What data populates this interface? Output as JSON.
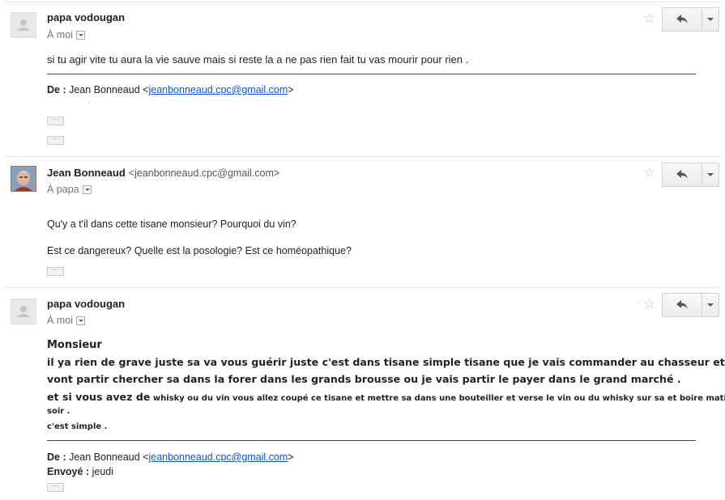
{
  "messages": [
    {
      "sender": "papa vodougan",
      "sender_email": "",
      "recipient": "À moi",
      "body": [
        "si tu agir vite tu aura la vie sauve mais si reste la a ne pas rien fait tu vas mourir pour rien ."
      ],
      "quote": {
        "from_label": "De :",
        "from_name": "Jean Bonneaud <",
        "from_email": "jeanbonneaud.cpc@gmail.com",
        "from_close": ">"
      },
      "ellipsis": [
        "···",
        "···"
      ]
    },
    {
      "sender": "Jean Bonneaud",
      "sender_email": "<jeanbonneaud.cpc@gmail.com>",
      "recipient": "À papa",
      "body": [
        "Qu'y a t'il dans cette tisane monsieur? Pourquoi du vin?",
        "Est ce dangereux? Quelle est la posologie? Est ce homéopathique?"
      ],
      "ellipsis": [
        "···"
      ]
    },
    {
      "sender": "papa vodougan",
      "sender_email": "",
      "recipient": "À moi",
      "body": {
        "salutation": "Monsieur",
        "line1": "il ya rien de grave juste sa va vous guérir  juste c'est dans tisane simple tisane que je vais commander au chasseur et ils",
        "line2": "vont partir chercher sa dans la forer dans les grands brousse ou je vais partir le payer dans le grand marché .",
        "line3_big": "et si vous avez de",
        "line3_small": " whisky ou du vin vous allez coupé ce tisane et mettre sa dans une bouteiller et verse le vin ou du whisky sur sa et boire matin midi",
        "line4": "soir .",
        "line5": "c'est simple ."
      },
      "quote": {
        "from_label": "De :",
        "from_name": "Jean Bonneaud <",
        "from_email": "jeanbonneaud.cpc@gmail.com",
        "from_close": ">",
        "sent_label": "Envoyé :",
        "sent_value": "jeudi"
      },
      "ellipsis": [
        "···"
      ]
    }
  ],
  "icons": {
    "star": "star-icon",
    "reply": "reply-icon",
    "more": "chevron-down-icon",
    "avatar": "avatar-icon"
  },
  "colors": {
    "link": "#1155cc",
    "star": "#c8c8c8",
    "separator": "#e5e5e5"
  }
}
